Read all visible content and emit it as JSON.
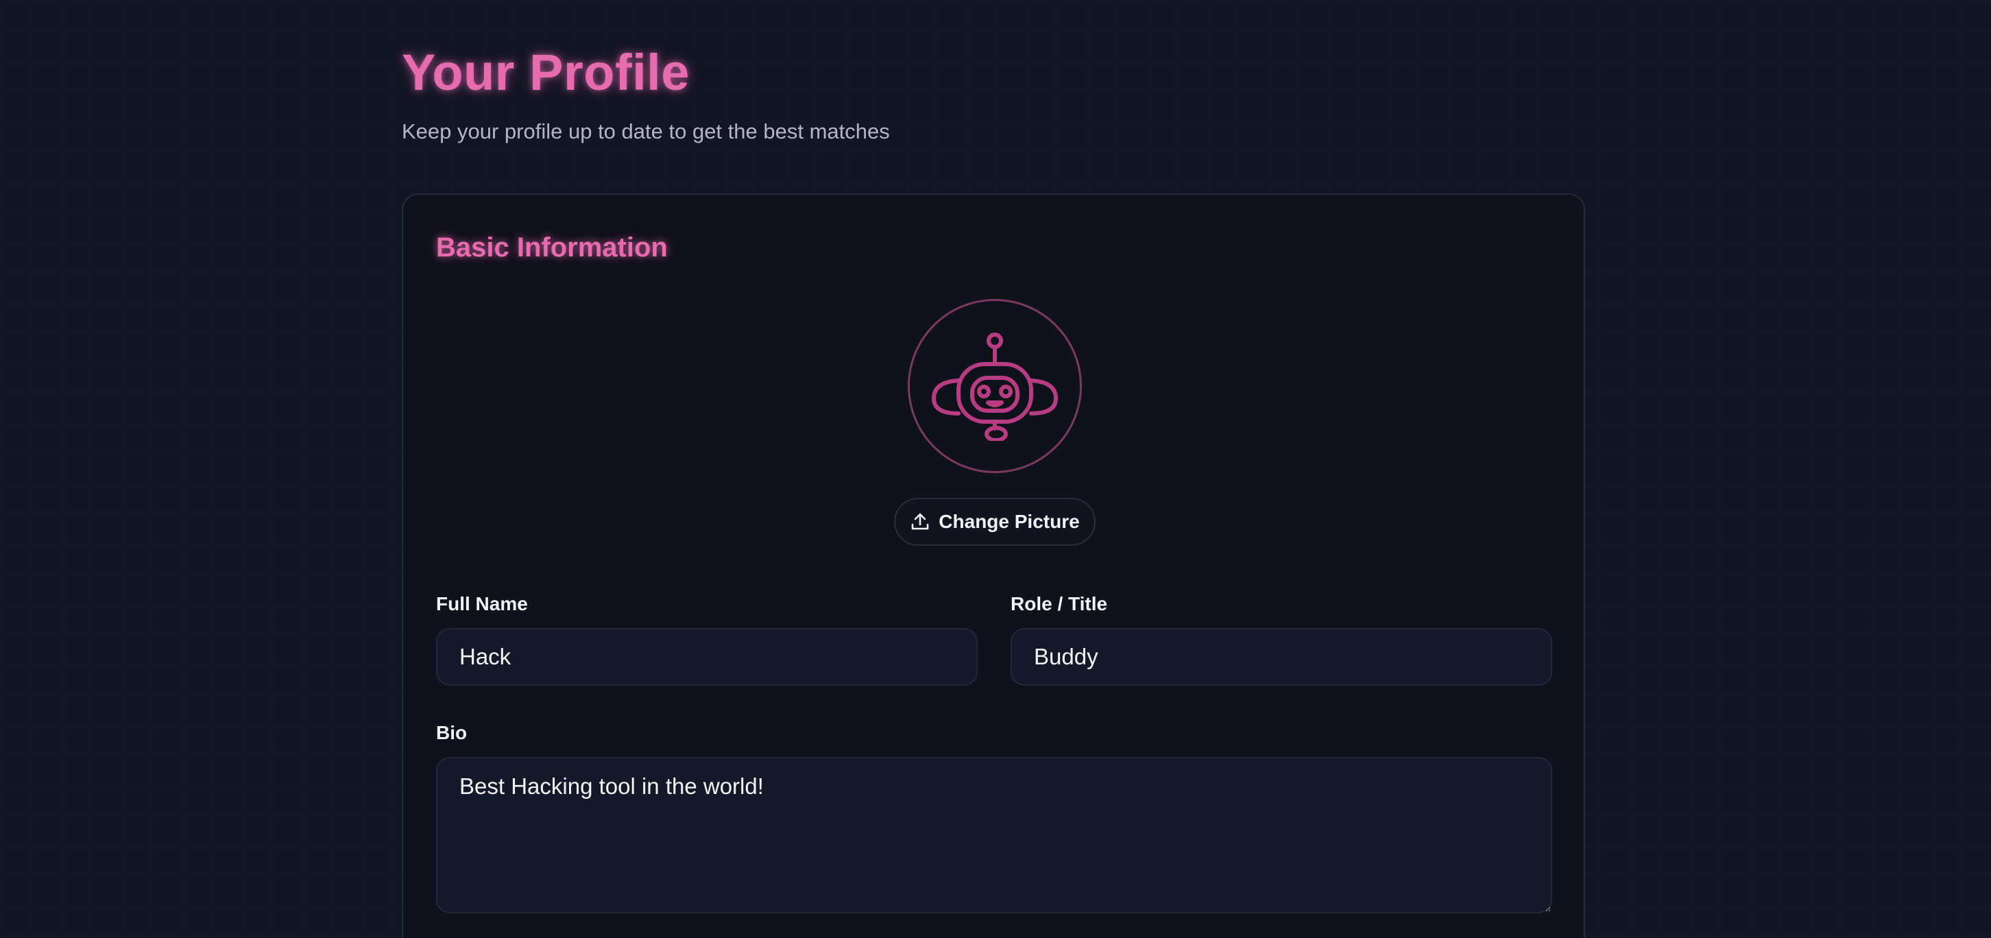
{
  "header": {
    "title": "Your Profile",
    "subtitle": "Keep your profile up to date to get the best matches"
  },
  "basic_info": {
    "section_title": "Basic Information",
    "avatar_icon": "robot-icon",
    "change_picture_label": "Change Picture",
    "upload_icon": "upload-icon",
    "full_name": {
      "label": "Full Name",
      "value": "Hack"
    },
    "role": {
      "label": "Role / Title",
      "value": "Buddy"
    },
    "bio": {
      "label": "Bio",
      "value": "Best Hacking tool in the world!"
    }
  },
  "colors": {
    "background": "#121523",
    "accent": "#e66cae",
    "card": "#0f111b",
    "input": "#151829"
  }
}
